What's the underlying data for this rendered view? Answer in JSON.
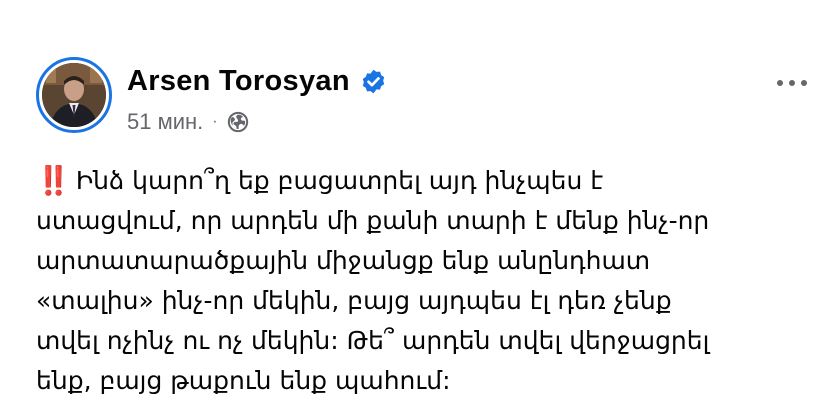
{
  "post": {
    "author_name": "Arsen Torosyan",
    "time": "51 мин.",
    "separator": "·",
    "emoji": "‼️",
    "lines": [
      "Ինձ կարո՞ղ եք բացատրել այդ ինչպես է",
      "ստացվում, որ արդեն մի քանի տարի է մենք ինչ-որ",
      "արտատարածքային միջանցք ենք անընդհատ",
      "«տալիս» ինչ-որ մեկին, բայց այդպես էլ դեռ չենք",
      "տվել ոչինչ ու ոչ մեկին: Թե՞ արդեն տվել վերջացրել",
      "ենք, բայց թաքուն ենք պահում:"
    ]
  },
  "icons": {
    "verified": "verified-badge-icon",
    "audience": "globe-icon",
    "more": "more-options-icon"
  },
  "colors": {
    "accent": "#1b74e4",
    "secondary_text": "#65676b",
    "emoji_red": "#e0245e"
  }
}
